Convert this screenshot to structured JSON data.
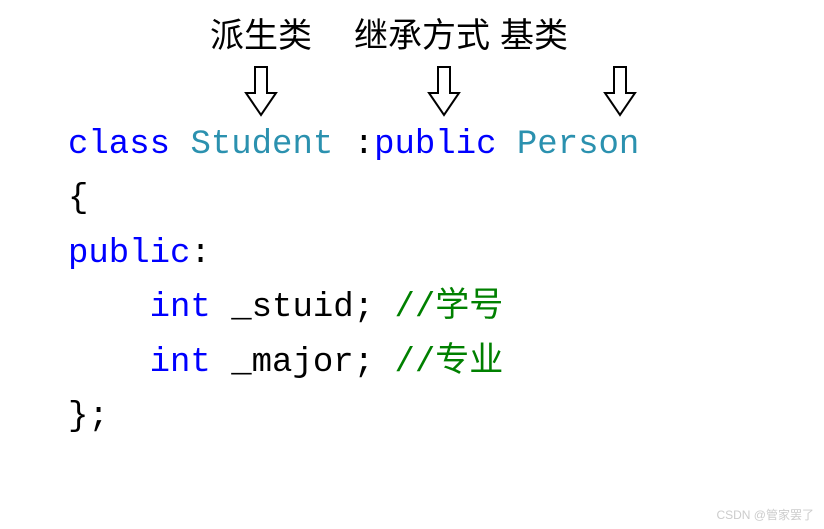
{
  "annotations": {
    "derived_class": "派生类",
    "inheritance_mode": "继承方式",
    "base_class": "基类"
  },
  "code": {
    "keyword_class": "class",
    "derived_type": "Student",
    "colon": " :",
    "access_specifier": "public",
    "base_type": "Person",
    "open_brace": "{",
    "member_access": "public",
    "member_colon": ":",
    "indent": "    ",
    "type_int": "int",
    "member1": "_stuid",
    "semicolon": ";",
    "comment1": "//学号",
    "member2": "_major",
    "comment2": "//专业",
    "close_brace": "};"
  },
  "watermark": "CSDN @管家罢了"
}
